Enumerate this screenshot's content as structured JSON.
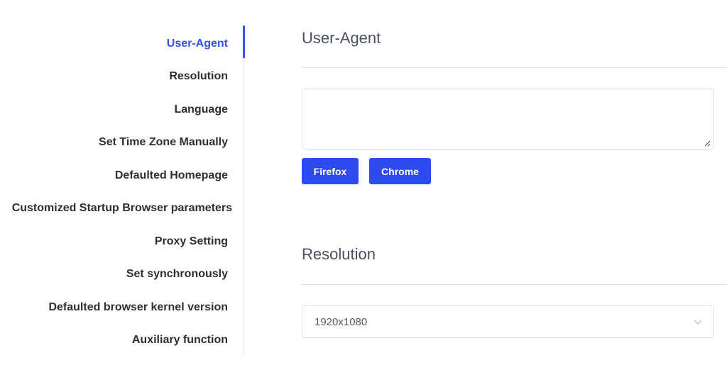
{
  "nav": {
    "items": [
      {
        "label": "User-Agent",
        "active": true
      },
      {
        "label": "Resolution"
      },
      {
        "label": "Language"
      },
      {
        "label": "Set Time Zone Manually"
      },
      {
        "label": "Defaulted Homepage"
      },
      {
        "label": "Customized Startup Browser parameters"
      },
      {
        "label": "Proxy Setting"
      },
      {
        "label": "Set synchronously"
      },
      {
        "label": "Defaulted browser kernel version"
      },
      {
        "label": "Auxiliary function"
      }
    ]
  },
  "user_agent": {
    "title": "User-Agent",
    "textarea_value": "",
    "buttons": {
      "firefox": "Firefox",
      "chrome": "Chrome"
    }
  },
  "resolution": {
    "title": "Resolution",
    "selected": "1920x1080"
  },
  "colors": {
    "accent": "#3452f0",
    "button": "#2d4bf0",
    "text": "#2b2f36",
    "heading": "#4a5060",
    "border": "#dcdfe5"
  },
  "icons": {
    "select_arrow": "chevron-down-icon",
    "textarea_resize": "resize-handle-icon"
  }
}
